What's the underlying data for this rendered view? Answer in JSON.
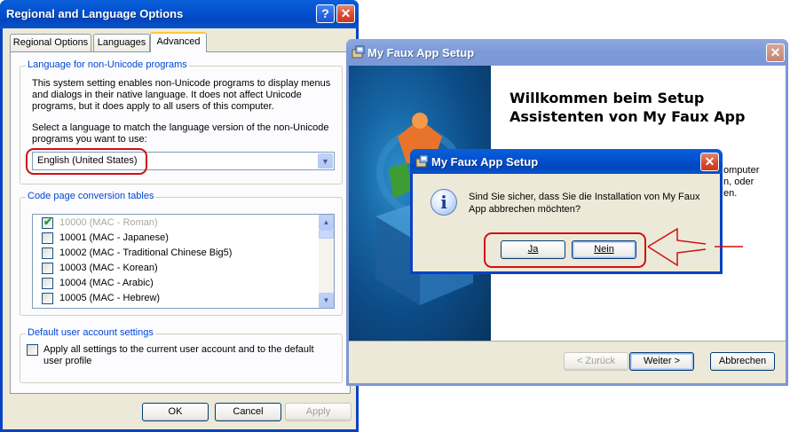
{
  "regional": {
    "title": "Regional and Language Options",
    "tabs": [
      "Regional Options",
      "Languages",
      "Advanced"
    ],
    "nonunicode": {
      "legend": "Language for non-Unicode programs",
      "description": "This system setting enables non-Unicode programs to display menus and dialogs in their native language. It does not affect Unicode programs, but it does apply to all users of this computer.",
      "select_prompt": "Select a language to match the language version of the non-Unicode programs you want to use:",
      "selected_language": "English (United States)"
    },
    "codepages": {
      "legend": "Code page conversion tables",
      "items": [
        {
          "label": "10000 (MAC - Roman)",
          "checked": true,
          "disabled": true
        },
        {
          "label": "10001 (MAC - Japanese)",
          "checked": false,
          "disabled": false
        },
        {
          "label": "10002 (MAC - Traditional Chinese Big5)",
          "checked": false,
          "disabled": false
        },
        {
          "label": "10003 (MAC - Korean)",
          "checked": false,
          "disabled": false
        },
        {
          "label": "10004 (MAC - Arabic)",
          "checked": false,
          "disabled": false
        },
        {
          "label": "10005 (MAC - Hebrew)",
          "checked": false,
          "disabled": false
        }
      ]
    },
    "default_user": {
      "legend": "Default user account settings",
      "apply_label": "Apply all settings to the current user account and to the default user profile"
    },
    "buttons": {
      "ok": "OK",
      "cancel": "Cancel",
      "apply": "Apply"
    }
  },
  "setup": {
    "title": "My Faux App Setup",
    "welcome_heading": "Willkommen beim Setup Assistenten von My Faux App",
    "partial_text": [
      "omputer",
      "n, oder",
      "en."
    ],
    "buttons": {
      "back": "< Zurück",
      "next": "Weiter >",
      "cancel": "Abbrechen"
    }
  },
  "confirm": {
    "title": "My Faux App Setup",
    "message": "Sind Sie sicher, dass Sie die Installation von My Faux App abbrechen möchten?",
    "yes": "Ja",
    "no": "Nein"
  },
  "colors": {
    "annotation": "#d01010",
    "titlebar_active": "#0a5fd8",
    "titlebar_inactive": "#7b97d4",
    "groupbox_legend": "#0046d5"
  },
  "icons": [
    "help-icon",
    "close-icon",
    "chevron-down-icon",
    "scroll-up-icon",
    "scroll-down-icon",
    "setup-app-icon",
    "info-icon",
    "puzzle-box-icon"
  ]
}
